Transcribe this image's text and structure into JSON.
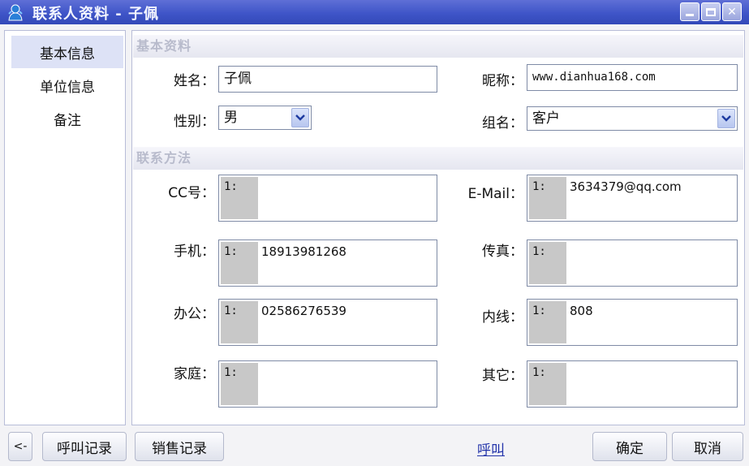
{
  "window": {
    "title": "联系人资料 - 子佩",
    "icon": "contact-app-icon"
  },
  "nav": {
    "items": [
      {
        "label": "基本信息",
        "active": true
      },
      {
        "label": "单位信息",
        "active": false
      },
      {
        "label": "备注",
        "active": false
      }
    ]
  },
  "basic": {
    "section_title": "基本资料",
    "name_label": "姓名：",
    "name_value": "子佩",
    "nickname_label": "昵称：",
    "nickname_value": "www.dianhua168.com",
    "gender_label": "性别：",
    "gender_value": "男",
    "group_label": "组名：",
    "group_value": "客户"
  },
  "contact": {
    "section_title": "联系方法",
    "cc_label": "CC号：",
    "cc_prefix": "1:",
    "cc_value": "",
    "email_label": "E-Mail：",
    "email_prefix": "1:",
    "email_value": "3634379@qq.com",
    "mobile_label": "手机：",
    "mobile_prefix": "1:",
    "mobile_value": "18913981268",
    "fax_label": "传真：",
    "fax_prefix": "1:",
    "fax_value": "",
    "office_label": "办公：",
    "office_prefix": "1:",
    "office_value": "02586276539",
    "ext_label": "内线：",
    "ext_prefix": "1:",
    "ext_value": "808",
    "home_label": "家庭：",
    "home_prefix": "1:",
    "home_value": "",
    "other_label": "其它：",
    "other_prefix": "1:",
    "other_value": ""
  },
  "footer": {
    "back_label": "<-",
    "call_log_label": "呼叫记录",
    "sales_log_label": "销售记录",
    "call_link": "呼叫",
    "ok_label": "确定",
    "cancel_label": "取消"
  },
  "colors": {
    "titlebar": "#3f55c8",
    "active_nav": "#dde2f6",
    "section_text": "#b8bbcc",
    "link": "#2233aa"
  }
}
